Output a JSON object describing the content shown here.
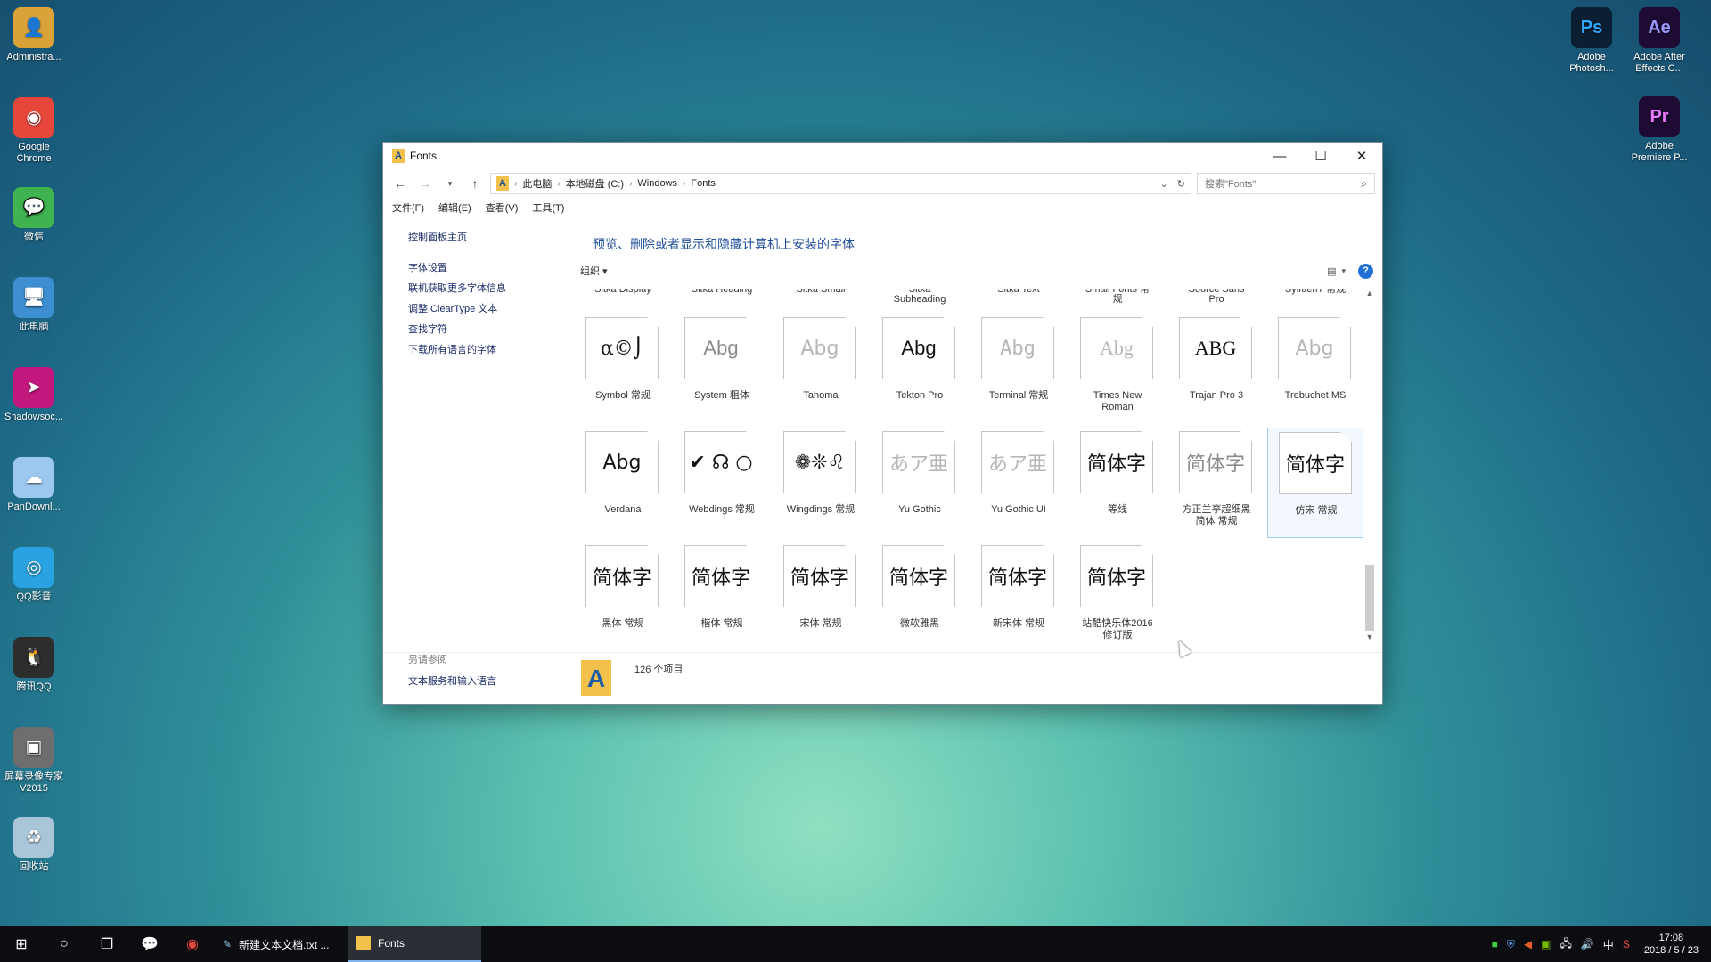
{
  "desktop_left": [
    {
      "label": "Administra...",
      "icon": "user-folder-icon",
      "glyph": "👤",
      "bg": "#d9a33a"
    },
    {
      "label": "Google\nChrome",
      "icon": "chrome-icon",
      "glyph": "◉",
      "bg": "#e7463b"
    },
    {
      "label": "微信",
      "icon": "wechat-icon",
      "glyph": "💬",
      "bg": "#3fb34f"
    },
    {
      "label": "此电脑",
      "icon": "computer-icon",
      "glyph": "🖥",
      "bg": "#3d8fd1"
    },
    {
      "label": "Shadowsoc...",
      "icon": "shadowsocks-icon",
      "glyph": "➤",
      "bg": "#c2187d"
    },
    {
      "label": "PanDownl...",
      "icon": "cloud-icon",
      "glyph": "☁",
      "bg": "#9cc7ef"
    },
    {
      "label": "QQ影音",
      "icon": "qq-player-icon",
      "glyph": "◎",
      "bg": "#28a2e0"
    },
    {
      "label": "腾讯QQ",
      "icon": "qq-penguin-icon",
      "glyph": "🐧",
      "bg": "#2d2d2d"
    },
    {
      "label": "屏幕录像专家\nV2015",
      "icon": "screen-recorder-icon",
      "glyph": "▣",
      "bg": "#6e6e6e"
    },
    {
      "label": "回收站",
      "icon": "recycle-bin-icon",
      "glyph": "♻",
      "bg": "#a9c6d8"
    }
  ],
  "desktop_right": [
    {
      "label": "Adobe\nPhotosh...",
      "icon": "photoshop-icon",
      "glyph": "Ps",
      "bg": "#0b1f33",
      "fg": "#31a8ff"
    },
    {
      "label": "Adobe After\nEffects C...",
      "icon": "after-effects-icon",
      "glyph": "Ae",
      "bg": "#1d0b33",
      "fg": "#9999ff"
    },
    {
      "label": "Adobe\nPremiere P...",
      "icon": "premiere-icon",
      "glyph": "Pr",
      "bg": "#1d0b33",
      "fg": "#ea77ff"
    }
  ],
  "window": {
    "title": "Fonts",
    "address": [
      "此电脑",
      "本地磁盘 (C:)",
      "Windows",
      "Fonts"
    ],
    "search_placeholder": "搜索\"Fonts\"",
    "menu": [
      "文件(F)",
      "编辑(E)",
      "查看(V)",
      "工具(T)"
    ],
    "sidebar": {
      "home": "控制面板主页",
      "links": [
        "字体设置",
        "联机获取更多字体信息",
        "调整 ClearType 文本",
        "查找字符",
        "下载所有语言的字体"
      ],
      "see_also_header": "另请参阅",
      "see_also": [
        "文本服务和输入语言"
      ]
    },
    "heading": "预览、删除或者显示和隐藏计算机上安装的字体",
    "organize": "组织 ▾",
    "clipped_row": [
      "Sitka Display",
      "Sitka Heading",
      "Sitka Small",
      "Sitka\nSubheading",
      "Sitka Text",
      "Small Fonts 常\n规",
      "Source Sans\nPro",
      "SylfaenT 常规"
    ],
    "fonts": [
      {
        "name": "Symbol 常规",
        "sample": "α©⌡",
        "tone": "dark",
        "family": "\"DejaVu Serif\", serif"
      },
      {
        "name": "System 粗体",
        "sample": "Abg",
        "tone": "mid",
        "family": "\"Liberation Sans\", sans-serif"
      },
      {
        "name": "Tahoma",
        "sample": "Abg",
        "tone": "light",
        "family": "\"DejaVu Sans\", sans-serif"
      },
      {
        "name": "Tekton Pro",
        "sample": "Abg",
        "tone": "dark",
        "family": "\"Liberation Sans\", sans-serif"
      },
      {
        "name": "Terminal 常规",
        "sample": "Abg",
        "tone": "light",
        "family": "\"DejaVu Sans Mono\", monospace"
      },
      {
        "name": "Times New\nRoman",
        "sample": "Abg",
        "tone": "light",
        "family": "\"Liberation Serif\", serif"
      },
      {
        "name": "Trajan Pro 3",
        "sample": "ABG",
        "tone": "dark",
        "family": "\"Liberation Serif\", serif"
      },
      {
        "name": "Trebuchet MS",
        "sample": "Abg",
        "tone": "light",
        "family": "\"DejaVu Sans\", sans-serif"
      },
      {
        "name": "Verdana",
        "sample": "Abg",
        "tone": "dark",
        "family": "\"DejaVu Sans\", sans-serif"
      },
      {
        "name": "Webdings 常规",
        "sample": "✔ ☊ ○",
        "tone": "dark",
        "family": "\"DejaVu Sans\", sans-serif"
      },
      {
        "name": "Wingdings 常规",
        "sample": "❁❊♌",
        "tone": "dark",
        "family": "\"DejaVu Sans\", sans-serif"
      },
      {
        "name": "Yu Gothic",
        "sample": "あア亜",
        "tone": "light",
        "family": "\"DejaVu Sans\", sans-serif"
      },
      {
        "name": "Yu Gothic UI",
        "sample": "あア亜",
        "tone": "light",
        "family": "\"DejaVu Sans\", sans-serif"
      },
      {
        "name": "等线",
        "sample": "简体字",
        "tone": "dark",
        "family": "\"DejaVu Sans\", sans-serif"
      },
      {
        "name": "方正兰亭超细黑\n简体 常规",
        "sample": "简体字",
        "tone": "mid",
        "family": "\"DejaVu Sans\", sans-serif"
      },
      {
        "name": "仿宋 常规",
        "sample": "简体字",
        "tone": "dark",
        "family": "\"DejaVu Serif\", serif",
        "selected": true
      },
      {
        "name": "黑体 常规",
        "sample": "简体字",
        "tone": "dark",
        "family": "\"DejaVu Sans\", sans-serif"
      },
      {
        "name": "楷体 常规",
        "sample": "简体字",
        "tone": "dark",
        "family": "\"DejaVu Serif\", serif"
      },
      {
        "name": "宋体 常规",
        "sample": "简体字",
        "tone": "dark",
        "family": "\"DejaVu Serif\", serif"
      },
      {
        "name": "微软雅黑",
        "sample": "简体字",
        "tone": "dark",
        "family": "\"DejaVu Sans\", sans-serif"
      },
      {
        "name": "新宋体 常规",
        "sample": "简体字",
        "tone": "dark",
        "family": "\"DejaVu Serif\", serif"
      },
      {
        "name": "站酷快乐体2016\n修订版",
        "sample": "简体字",
        "tone": "dark",
        "family": "\"DejaVu Sans\", sans-serif"
      }
    ],
    "status": "126 个项目"
  },
  "taskbar": {
    "tasks": [
      {
        "label": "新建文本文档.txt ...",
        "icon": "notepad-icon",
        "active": false
      },
      {
        "label": "Fonts",
        "icon": "fonts-folder-icon",
        "active": true
      }
    ],
    "ime": "中",
    "time": "17:08",
    "date": "2018 / 5 / 23"
  }
}
